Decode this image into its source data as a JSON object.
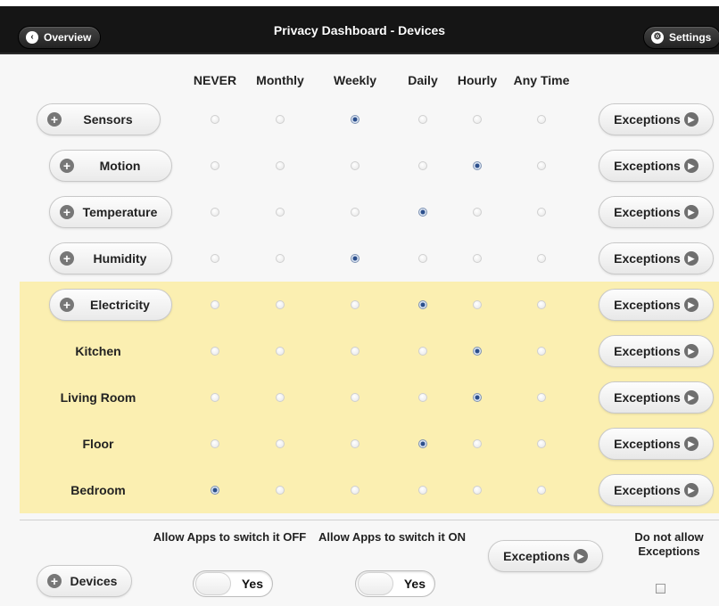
{
  "header": {
    "title": "Privacy Dashboard - Devices",
    "back_label": "Overview",
    "settings_label": "Settings",
    "back_icon": "chevron-left-icon",
    "settings_icon": "gear-icon"
  },
  "columns": [
    "NEVER",
    "Monthly",
    "Weekly",
    "Daily",
    "Hourly",
    "Any Time"
  ],
  "rows": [
    {
      "label": "Sensors",
      "type": "category",
      "selected": 2,
      "exceptions_label": "Exceptions",
      "highlighted": false
    },
    {
      "label": "Motion",
      "type": "category",
      "selected": 4,
      "exceptions_label": "Exceptions",
      "highlighted": false
    },
    {
      "label": "Temperature",
      "type": "category",
      "selected": 3,
      "exceptions_label": "Exceptions",
      "highlighted": false
    },
    {
      "label": "Humidity",
      "type": "category",
      "selected": 2,
      "exceptions_label": "Exceptions",
      "highlighted": false
    },
    {
      "label": "Electricity",
      "type": "category",
      "selected": 3,
      "exceptions_label": "Exceptions",
      "highlighted": true
    },
    {
      "label": "Kitchen",
      "type": "item",
      "selected": 4,
      "exceptions_label": "Exceptions",
      "highlighted": true
    },
    {
      "label": "Living Room",
      "type": "item",
      "selected": 4,
      "exceptions_label": "Exceptions",
      "highlighted": true
    },
    {
      "label": "Floor",
      "type": "item",
      "selected": 3,
      "exceptions_label": "Exceptions",
      "highlighted": true
    },
    {
      "label": "Bedroom",
      "type": "item",
      "selected": 0,
      "exceptions_label": "Exceptions",
      "highlighted": true
    }
  ],
  "footer": {
    "devices_label": "Devices",
    "allow_off_label": "Allow Apps to switch it OFF",
    "allow_on_label": "Allow Apps to switch it ON",
    "toggle_off_value": "Yes",
    "toggle_on_value": "Yes",
    "exceptions_label": "Exceptions",
    "no_exceptions_label": "Do not allow Exceptions",
    "no_exceptions_checked": false
  },
  "colors": {
    "header_bg": "#151515",
    "highlight_bg": "#fbefb1",
    "radio_selected": "#2c4f8c"
  }
}
